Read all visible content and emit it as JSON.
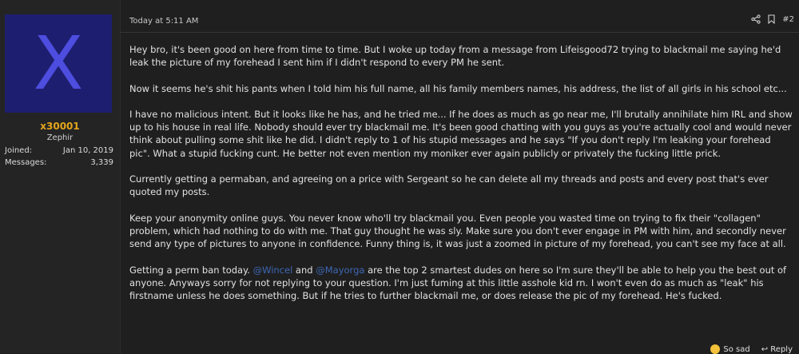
{
  "user": {
    "avatar_letter": "X",
    "name": "x30001",
    "title": "Zephir",
    "joined_label": "Joined:",
    "joined_value": "Jan 10, 2019",
    "messages_label": "Messages:",
    "messages_value": "3,339"
  },
  "post": {
    "timestamp": "Today at 5:11 AM",
    "number": "#2",
    "paragraphs": {
      "p1": "Hey bro, it's been good on here from time to time. But I woke up today from a message from Lifeisgood72 trying to blackmail me saying he'd leak the picture of my forehead I sent him if I didn't respond to every PM he sent.",
      "p2": "Now it seems he's shit his pants when I told him his full name, all his family members names, his address, the list of all girls in his school etc...",
      "p3": "I have no malicious intent. But it looks like he has, and he tried me... If he does as much as go near me, I'll brutally annihilate him IRL and show up to his house in real life. Nobody should ever try blackmail me. It's been good chatting with you guys as you're actually cool and would never think about pulling some shit like he did. I didn't reply to 1 of his stupid messages and he says \"If you don't reply I'm leaking your forehead pic\". What a stupid fucking cunt. He better not even mention my moniker ever again publicly or privately the fucking little prick.",
      "p4": "Currently getting a permaban, and agreeing on a price with Sergeant so he can delete all my threads and posts and every post that's ever quoted my posts.",
      "p5": "Keep your anonymity online guys. You never know who'll try blackmail you. Even people you wasted time on trying to fix their \"collagen\" problem, which had nothing to do with me. That guy thought he was sly. Make sure you don't ever engage in PM with him, and secondly never send any type of pictures to anyone in confidence. Funny thing is, it was just a zoomed in picture of my forehead, you can't see my face at all.",
      "p6_a": "Getting a perm ban today. ",
      "p6_mention1": "@Wincel",
      "p6_b": " and ",
      "p6_mention2": "@Mayorga",
      "p6_c": " are the top 2 smartest dudes on here so I'm sure they'll be able to help you the best out of anyone. Anyways sorry for not replying to your question. I'm just fuming at this little asshole kid rn. I won't even do as much as \"leak\" his firstname unless he does something. But if he tries to further blackmail me, or does release the pic of my forehead. He's fucked."
    },
    "footer": {
      "reaction_label": "So sad",
      "reply_label": "Reply"
    }
  },
  "icons": [
    "share-icon",
    "bookmark-icon",
    "sad-emoji-icon",
    "reply-icon"
  ],
  "colors": {
    "background": "#1f1f1f",
    "avatar_bg": "#1e1e70",
    "avatar_letter": "#4d4de0",
    "username": "#e3a51a",
    "mention": "#3e67b6"
  }
}
